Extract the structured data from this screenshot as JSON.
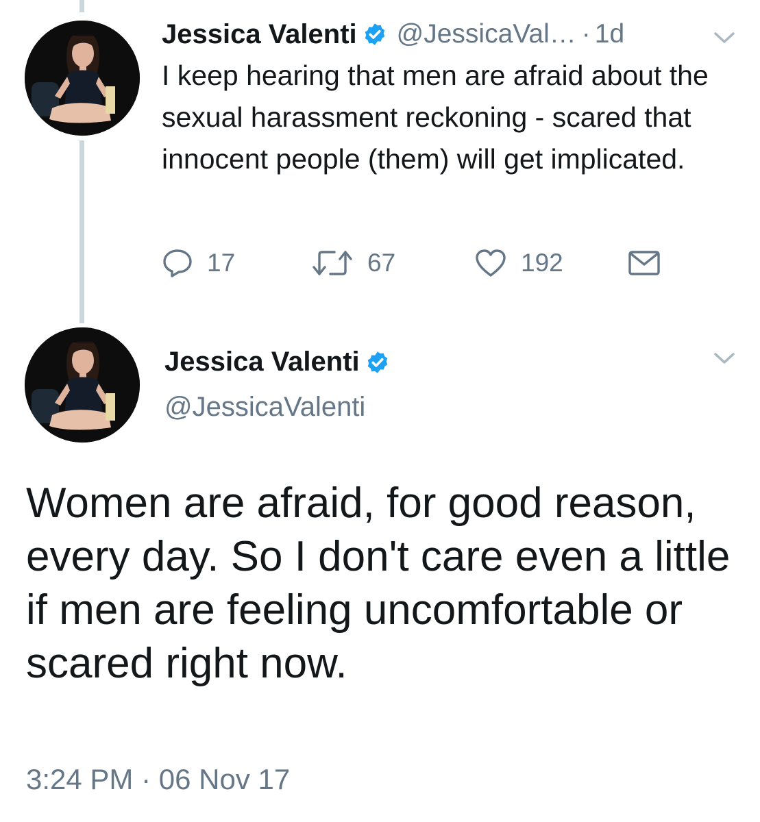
{
  "tweet1": {
    "author_name": "Jessica Valenti",
    "handle": "@JessicaVal…",
    "separator": "·",
    "time": "1d",
    "text": "I keep hearing that men are afraid about the sexual harassment reckoning - scared that innocent people (them) will get implicated.",
    "actions": {
      "reply_count": "17",
      "retweet_count": "67",
      "like_count": "192"
    },
    "icons": [
      "reply-icon",
      "retweet-icon",
      "heart-icon",
      "envelope-icon",
      "chevron-down-icon",
      "verified-badge-icon"
    ]
  },
  "tweet2": {
    "author_name": "Jessica Valenti",
    "handle": "@JessicaValenti",
    "text": "Women are afraid, for good reason, every day. So I don't care even a little if men are feeling uncomfortable or scared right now.",
    "timestamp": "3:24 PM · 06 Nov 17"
  },
  "colors": {
    "text_primary": "#14171a",
    "text_secondary": "#657786",
    "verified_blue": "#1da1f2",
    "thread_line": "#ccd6dd",
    "background": "#ffffff"
  }
}
